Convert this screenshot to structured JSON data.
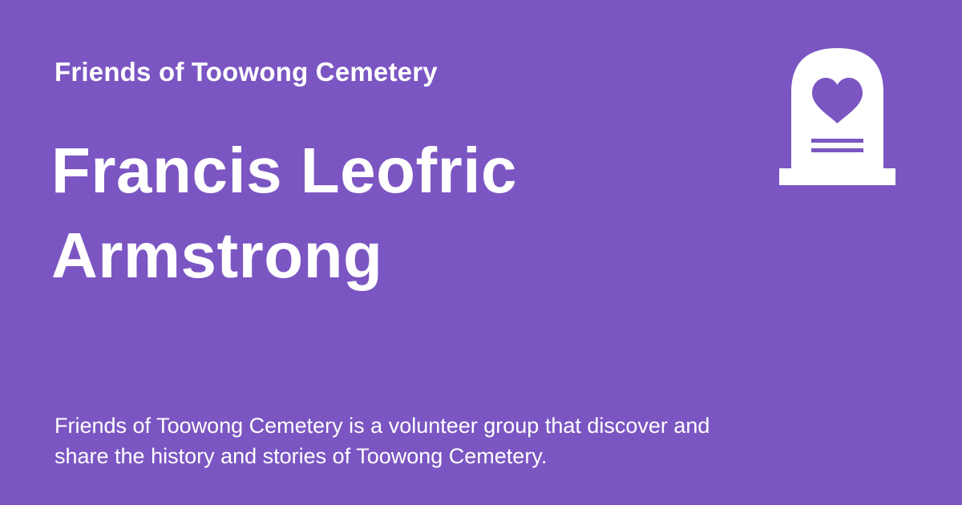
{
  "card": {
    "organization": "Friends of Toowong Cemetery",
    "title_line_1": "Francis Leofric",
    "title_line_2": "Armstrong",
    "description": "Friends of Toowong Cemetery is a volunteer group that discover and share the history and stories of Toowong Cemetery.",
    "logo_icon": "headstone-heart-icon"
  },
  "colors": {
    "background": "#7b56c2",
    "text": "#ffffff"
  }
}
